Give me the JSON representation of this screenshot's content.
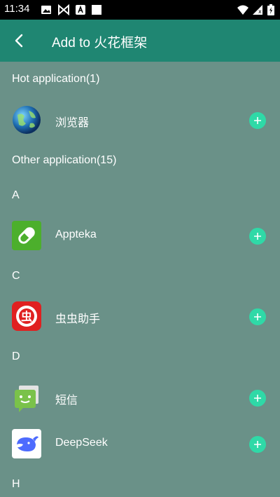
{
  "status_bar": {
    "time": "11:34",
    "icons": [
      "image-icon",
      "bowtie-icon",
      "a-box-icon",
      "square-icon",
      "wifi-icon",
      "signal-icon",
      "battery-icon"
    ]
  },
  "header": {
    "title": "Add to 火花框架",
    "back_icon": "chevron-left-icon"
  },
  "sections": {
    "hot_title": "Hot application(1)",
    "other_title": "Other application(15)"
  },
  "letters": [
    "A",
    "C",
    "D",
    "H"
  ],
  "apps": [
    {
      "label": "浏览器",
      "icon": "globe-icon"
    },
    {
      "label": "Appteka",
      "icon": "capsule-icon"
    },
    {
      "label": "虫虫助手",
      "icon": "chongchong-icon"
    },
    {
      "label": "短信",
      "icon": "sms-icon"
    },
    {
      "label": "DeepSeek",
      "icon": "whale-icon"
    }
  ],
  "colors": {
    "background": "#6a9188",
    "appbar": "#1f8672",
    "add_button": "#2fd9a7"
  }
}
